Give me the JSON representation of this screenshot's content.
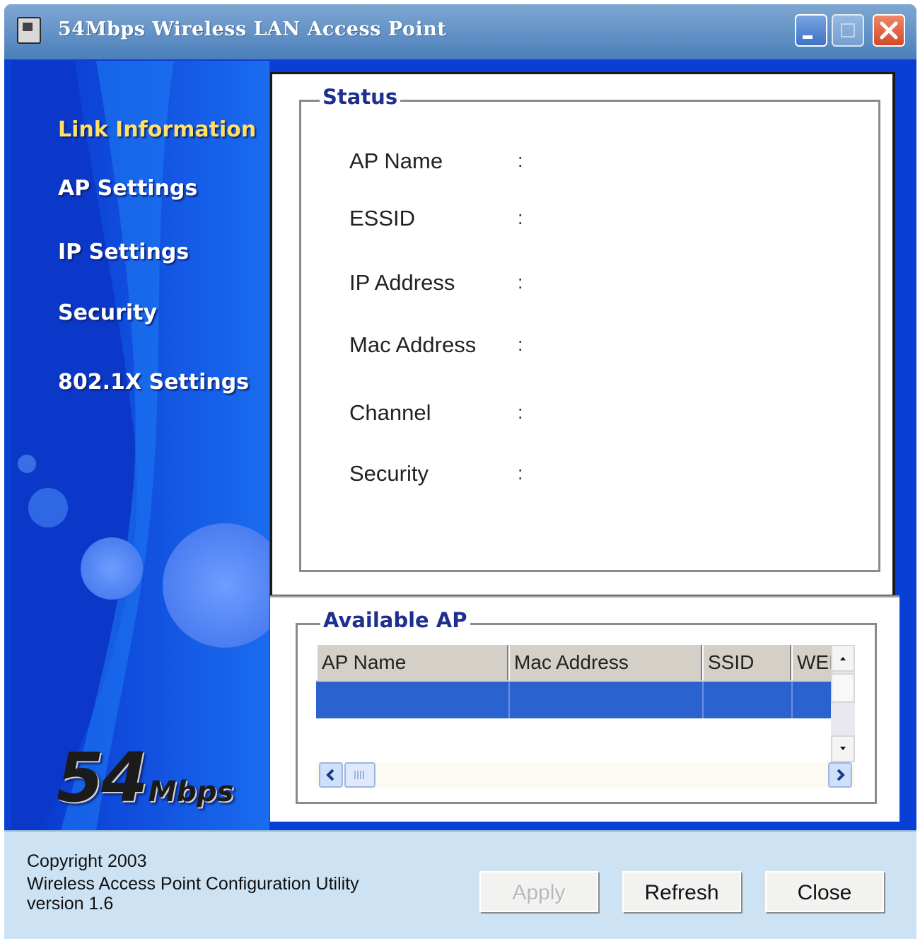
{
  "window": {
    "title": "54Mbps Wireless LAN Access Point"
  },
  "sidebar": {
    "items": [
      {
        "label": "Link Information",
        "active": true
      },
      {
        "label": "AP Settings",
        "active": false
      },
      {
        "label": "IP Settings",
        "active": false
      },
      {
        "label": "Security",
        "active": false
      },
      {
        "label": "802.1X Settings",
        "active": false
      }
    ],
    "logo": {
      "number": "54",
      "unit": "Mbps"
    }
  },
  "status": {
    "title": "Status",
    "fields": [
      {
        "label": "AP Name",
        "sep": ":",
        "value": ""
      },
      {
        "label": "ESSID",
        "sep": ":",
        "value": ""
      },
      {
        "label": "IP Address",
        "sep": ":",
        "value": ""
      },
      {
        "label": "Mac Address",
        "sep": ":",
        "value": ""
      },
      {
        "label": "Channel",
        "sep": ":",
        "value": ""
      },
      {
        "label": "Security",
        "sep": ":",
        "value": ""
      }
    ]
  },
  "available_ap": {
    "title": "Available AP",
    "columns": [
      "AP Name",
      "Mac Address",
      "SSID",
      "WEI"
    ]
  },
  "footer": {
    "copyright": "Copyright 2003",
    "product": "Wireless Access Point Configuration Utility",
    "version": "version 1.6",
    "buttons": {
      "apply": "Apply",
      "refresh": "Refresh",
      "close": "Close"
    }
  },
  "colors": {
    "sidebar_blue": "#0a3fd6",
    "active_nav": "#ffe066",
    "group_title": "#1f2f8f",
    "selection": "#2a62cf"
  }
}
